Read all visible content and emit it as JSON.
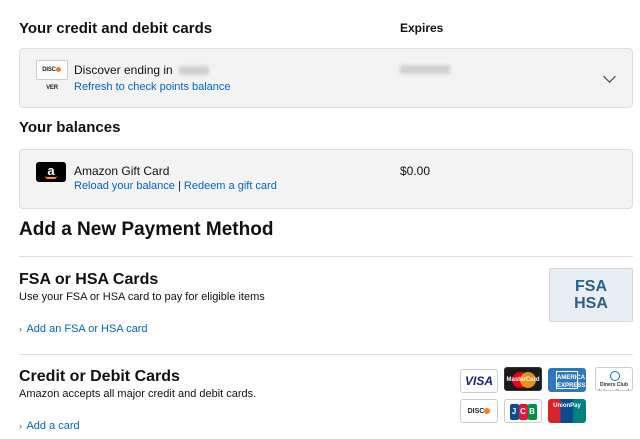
{
  "cards_section": {
    "title": "Your credit and debit cards",
    "expires_header": "Expires",
    "card": {
      "logo_text": "DISCOVER",
      "name": "Discover ending in",
      "points_link": "Refresh to check points balance"
    }
  },
  "balances_section": {
    "title": "Your balances",
    "gift_card": {
      "logo_text": "a",
      "name": "Amazon Gift Card",
      "reload_link": "Reload your balance",
      "separator": "|",
      "redeem_link": "Redeem a gift card",
      "amount": "$0.00"
    }
  },
  "add_payment": {
    "title": "Add a New Payment Method",
    "fsa": {
      "title": "FSA or HSA Cards",
      "description": "Use your FSA or HSA card to pay for eligible items",
      "add_link": "Add an FSA or HSA card",
      "badge_line1": "FSA",
      "badge_line2": "HSA"
    },
    "credit": {
      "title": "Credit or Debit Cards",
      "description": "Amazon accepts all major credit and debit cards.",
      "add_link": "Add a card",
      "logos": {
        "visa": "VISA",
        "mastercard": "MasterCard",
        "amex": "AMERICAN EXPRESS",
        "diners": "Diners Club International",
        "discover": "DISCOVER",
        "jcb": "JCB",
        "unionpay": "UnionPay"
      }
    }
  },
  "colors": {
    "link": "#0066c0",
    "panel_bg": "#f3f3f3",
    "fsa_text": "#2b5f8c"
  },
  "icons": {
    "expand": "chevron-down-icon",
    "link_expand": "chevron-right-icon"
  }
}
